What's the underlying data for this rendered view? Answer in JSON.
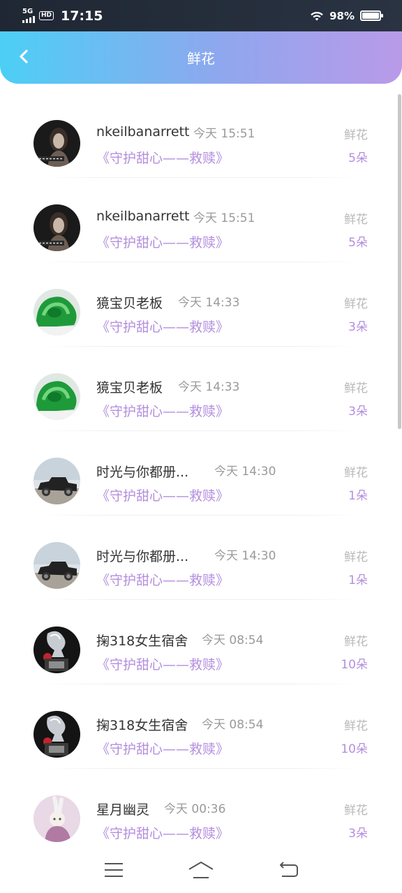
{
  "status_bar": {
    "network": "5G",
    "hd": "HD",
    "time": "17:15",
    "battery": "98%",
    "battery_level": 0.98
  },
  "header": {
    "title": "鲜花",
    "back_icon": "chevron-left-icon"
  },
  "list": [
    {
      "name": "nkeilbanarrett",
      "time": "今天 15:51",
      "book": "《守护甜心——救赎》",
      "gift": "鲜花",
      "count": "5朵",
      "avatar": "woman-portrait"
    },
    {
      "name": "nkeilbanarrett",
      "time": "今天 15:51",
      "book": "《守护甜心——救赎》",
      "gift": "鲜花",
      "count": "5朵",
      "avatar": "woman-portrait"
    },
    {
      "name": "獍宝贝老板",
      "time": "今天 14:33",
      "book": "《守护甜心——救赎》",
      "gift": "鲜花",
      "count": "3朵",
      "avatar": "green-jade"
    },
    {
      "name": "獍宝贝老板",
      "time": "今天 14:33",
      "book": "《守护甜心——救赎》",
      "gift": "鲜花",
      "count": "3朵",
      "avatar": "green-jade"
    },
    {
      "name": "时光与你都册...",
      "time": "今天 14:30",
      "book": "《守护甜心——救赎》",
      "gift": "鲜花",
      "count": "1朵",
      "avatar": "vintage-car"
    },
    {
      "name": "时光与你都册...",
      "time": "今天 14:30",
      "book": "《守护甜心——救赎》",
      "gift": "鲜花",
      "count": "1朵",
      "avatar": "vintage-car"
    },
    {
      "name": "掬318女生宿舍",
      "time": "今天 08:54",
      "book": "《守护甜心——救赎》",
      "gift": "鲜花",
      "count": "10朵",
      "avatar": "crystal-figure"
    },
    {
      "name": "掬318女生宿舍",
      "time": "今天 08:54",
      "book": "《守护甜心——救赎》",
      "gift": "鲜花",
      "count": "10朵",
      "avatar": "crystal-figure"
    },
    {
      "name": "星月幽灵",
      "time": "今天 00:36",
      "book": "《守护甜心——救赎》",
      "gift": "鲜花",
      "count": "3朵",
      "avatar": "anime-figure"
    }
  ],
  "nav_bar": {
    "menu_icon": "menu-icon",
    "home_icon": "home-icon",
    "back_icon": "back-icon"
  }
}
